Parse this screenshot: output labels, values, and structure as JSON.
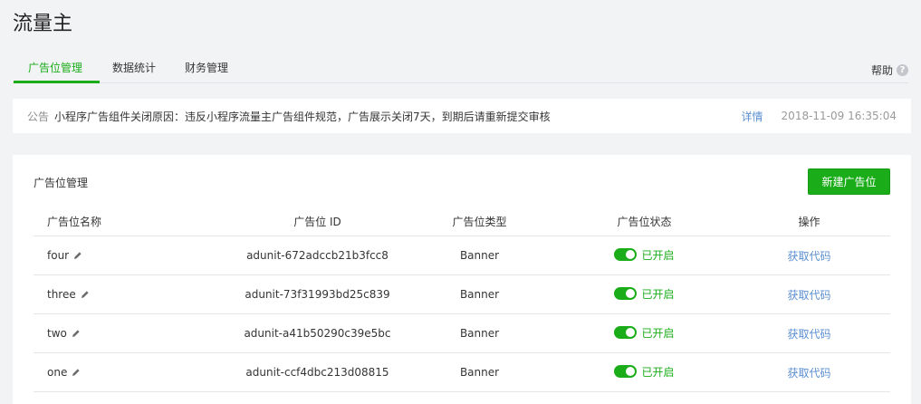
{
  "page": {
    "title": "流量主"
  },
  "tabs": [
    {
      "label": "广告位管理",
      "active": true
    },
    {
      "label": "数据统计",
      "active": false
    },
    {
      "label": "财务管理",
      "active": false
    }
  ],
  "help": {
    "label": "帮助",
    "icon": "question-circle-icon"
  },
  "notice": {
    "label": "公告",
    "text": "小程序广告组件关闭原因：违反小程序流量主广告组件规范，广告展示关闭7天，到期后请重新提交审核",
    "link": "详情",
    "time": "2018-11-09 16:35:04"
  },
  "card": {
    "title": "广告位管理",
    "new_button": "新建广告位"
  },
  "table": {
    "headers": [
      "广告位名称",
      "广告位 ID",
      "广告位类型",
      "广告位状态",
      "操作"
    ],
    "rows": [
      {
        "name": "four",
        "id": "adunit-672adccb21b3fcc8",
        "type": "Banner",
        "status": "已开启",
        "action": "获取代码"
      },
      {
        "name": "three",
        "id": "adunit-73f31993bd25c839",
        "type": "Banner",
        "status": "已开启",
        "action": "获取代码"
      },
      {
        "name": "two",
        "id": "adunit-a41b50290c39e5bc",
        "type": "Banner",
        "status": "已开启",
        "action": "获取代码"
      },
      {
        "name": "one",
        "id": "adunit-ccf4dbc213d08815",
        "type": "Banner",
        "status": "已开启",
        "action": "获取代码"
      }
    ]
  },
  "colors": {
    "accent": "#1aad19",
    "link": "#5b8fd1"
  }
}
